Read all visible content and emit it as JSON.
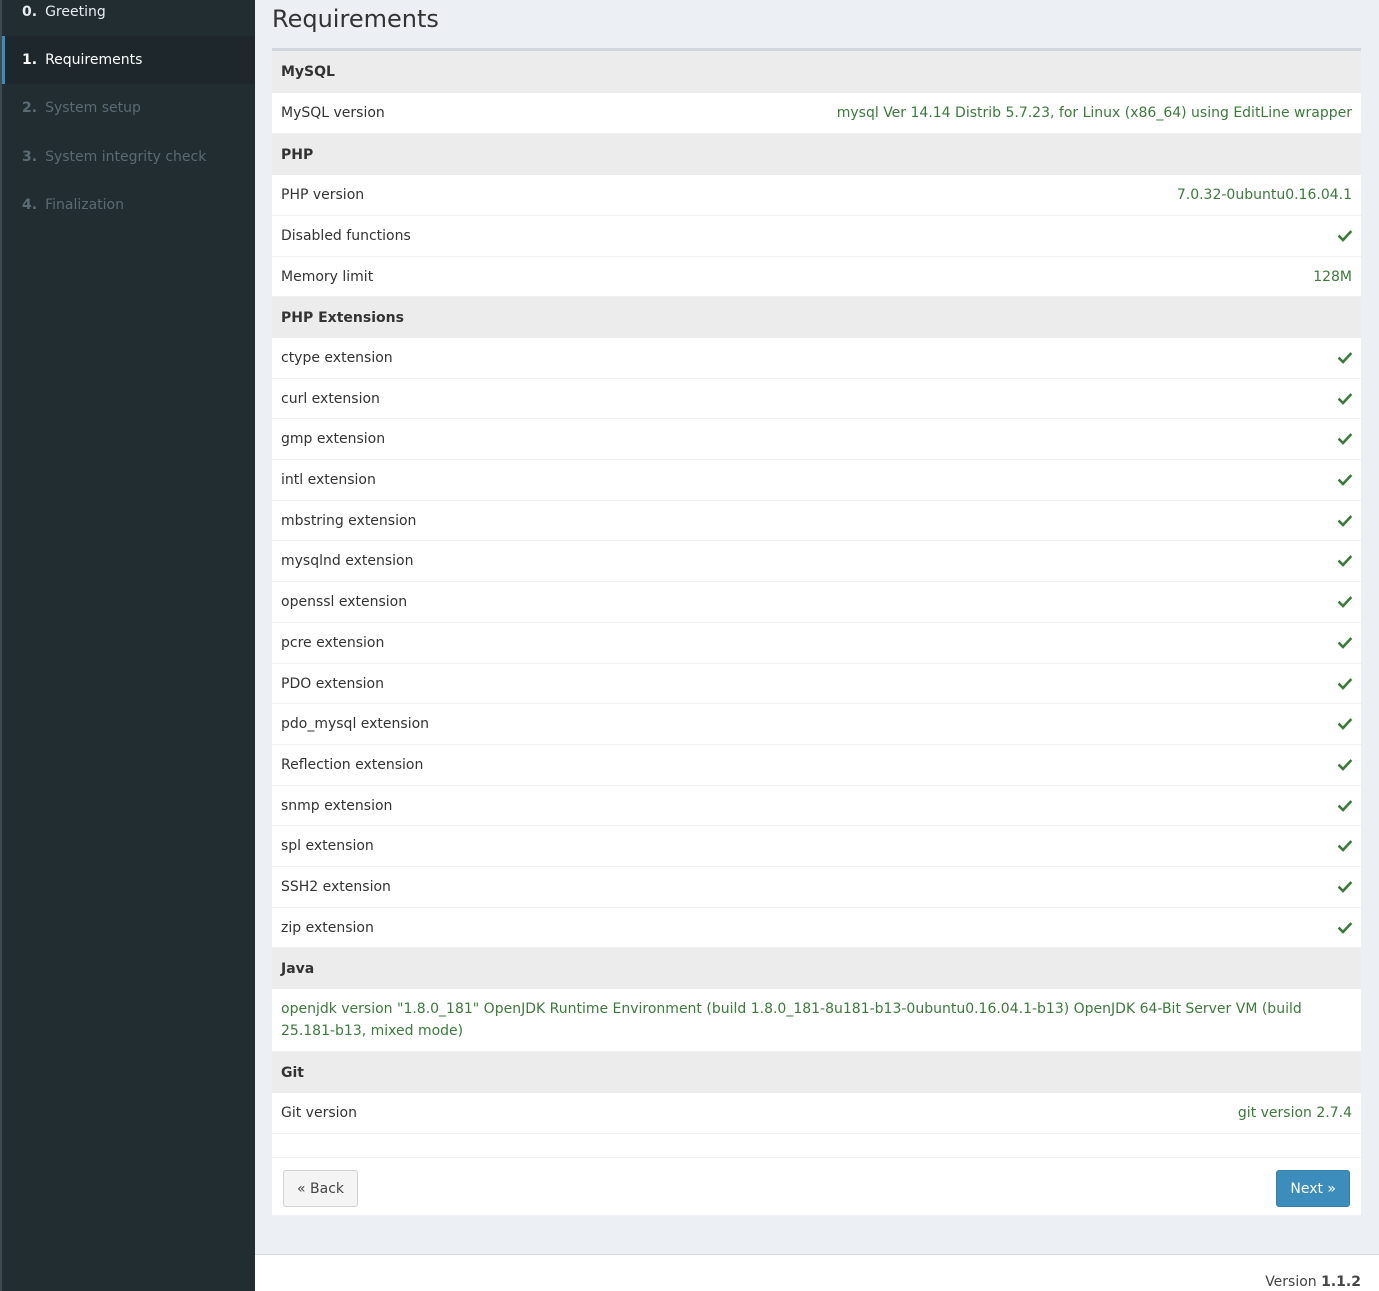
{
  "sidebar": {
    "steps": [
      {
        "num": "0.",
        "label": "Greeting",
        "state": "done"
      },
      {
        "num": "1.",
        "label": "Requirements",
        "state": "active"
      },
      {
        "num": "2.",
        "label": "System setup",
        "state": "pending"
      },
      {
        "num": "3.",
        "label": "System integrity check",
        "state": "pending"
      },
      {
        "num": "4.",
        "label": "Finalization",
        "state": "pending"
      }
    ]
  },
  "page": {
    "title": "Requirements"
  },
  "sections": {
    "mysql": {
      "title": "MySQL",
      "rows": [
        {
          "label": "MySQL version",
          "value": "mysql Ver 14.14 Distrib 5.7.23, for Linux (x86_64) using EditLine wrapper"
        }
      ]
    },
    "php": {
      "title": "PHP",
      "rows": [
        {
          "label": "PHP version",
          "value": "7.0.32-0ubuntu0.16.04.1"
        },
        {
          "label": "Disabled functions",
          "status": "ok"
        },
        {
          "label": "Memory limit",
          "value": "128M"
        }
      ]
    },
    "php_extensions": {
      "title": "PHP Extensions",
      "rows": [
        {
          "label": "ctype extension",
          "status": "ok"
        },
        {
          "label": "curl extension",
          "status": "ok"
        },
        {
          "label": "gmp extension",
          "status": "ok"
        },
        {
          "label": "intl extension",
          "status": "ok"
        },
        {
          "label": "mbstring extension",
          "status": "ok"
        },
        {
          "label": "mysqlnd extension",
          "status": "ok"
        },
        {
          "label": "openssl extension",
          "status": "ok"
        },
        {
          "label": "pcre extension",
          "status": "ok"
        },
        {
          "label": "PDO extension",
          "status": "ok"
        },
        {
          "label": "pdo_mysql extension",
          "status": "ok"
        },
        {
          "label": "Reflection extension",
          "status": "ok"
        },
        {
          "label": "snmp extension",
          "status": "ok"
        },
        {
          "label": "spl extension",
          "status": "ok"
        },
        {
          "label": "SSH2 extension",
          "status": "ok"
        },
        {
          "label": "zip extension",
          "status": "ok"
        }
      ]
    },
    "java": {
      "title": "Java",
      "text": "openjdk version \"1.8.0_181\" OpenJDK Runtime Environment (build 1.8.0_181-8u181-b13-0ubuntu0.16.04.1-b13) OpenJDK 64-Bit Server VM (build 25.181-b13, mixed mode)"
    },
    "git": {
      "title": "Git",
      "rows": [
        {
          "label": "Git version",
          "value": "git version 2.7.4"
        }
      ]
    }
  },
  "buttons": {
    "back_label": "« Back",
    "next_label": "Next »"
  },
  "footer": {
    "version_prefix": "Version",
    "version_number": "1.1.2"
  },
  "icons": {
    "check": "check-icon"
  },
  "colors": {
    "sidebar_bg": "#222d32",
    "ok_green": "#3c7a3c",
    "primary_blue": "#3c8dbc"
  }
}
